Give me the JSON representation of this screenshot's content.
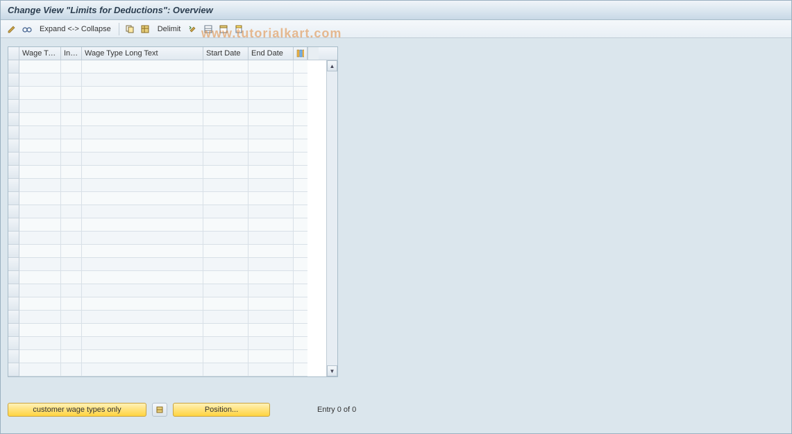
{
  "header": {
    "title": "Change View \"Limits for Deductions\": Overview"
  },
  "toolbar": {
    "expand_collapse_label": "Expand <-> Collapse",
    "delimit_label": "Delimit"
  },
  "table": {
    "columns": {
      "sel": "",
      "wage_type": "Wage Ty...",
      "inf": "Inf...",
      "long_text": "Wage Type Long Text",
      "start_date": "Start Date",
      "end_date": "End Date"
    },
    "rows": [
      {
        "wage_type": "",
        "inf": "",
        "long_text": "",
        "start_date": "",
        "end_date": ""
      },
      {
        "wage_type": "",
        "inf": "",
        "long_text": "",
        "start_date": "",
        "end_date": ""
      },
      {
        "wage_type": "",
        "inf": "",
        "long_text": "",
        "start_date": "",
        "end_date": ""
      },
      {
        "wage_type": "",
        "inf": "",
        "long_text": "",
        "start_date": "",
        "end_date": ""
      },
      {
        "wage_type": "",
        "inf": "",
        "long_text": "",
        "start_date": "",
        "end_date": ""
      },
      {
        "wage_type": "",
        "inf": "",
        "long_text": "",
        "start_date": "",
        "end_date": ""
      },
      {
        "wage_type": "",
        "inf": "",
        "long_text": "",
        "start_date": "",
        "end_date": ""
      },
      {
        "wage_type": "",
        "inf": "",
        "long_text": "",
        "start_date": "",
        "end_date": ""
      },
      {
        "wage_type": "",
        "inf": "",
        "long_text": "",
        "start_date": "",
        "end_date": ""
      },
      {
        "wage_type": "",
        "inf": "",
        "long_text": "",
        "start_date": "",
        "end_date": ""
      },
      {
        "wage_type": "",
        "inf": "",
        "long_text": "",
        "start_date": "",
        "end_date": ""
      },
      {
        "wage_type": "",
        "inf": "",
        "long_text": "",
        "start_date": "",
        "end_date": ""
      },
      {
        "wage_type": "",
        "inf": "",
        "long_text": "",
        "start_date": "",
        "end_date": ""
      },
      {
        "wage_type": "",
        "inf": "",
        "long_text": "",
        "start_date": "",
        "end_date": ""
      },
      {
        "wage_type": "",
        "inf": "",
        "long_text": "",
        "start_date": "",
        "end_date": ""
      },
      {
        "wage_type": "",
        "inf": "",
        "long_text": "",
        "start_date": "",
        "end_date": ""
      },
      {
        "wage_type": "",
        "inf": "",
        "long_text": "",
        "start_date": "",
        "end_date": ""
      },
      {
        "wage_type": "",
        "inf": "",
        "long_text": "",
        "start_date": "",
        "end_date": ""
      },
      {
        "wage_type": "",
        "inf": "",
        "long_text": "",
        "start_date": "",
        "end_date": ""
      },
      {
        "wage_type": "",
        "inf": "",
        "long_text": "",
        "start_date": "",
        "end_date": ""
      },
      {
        "wage_type": "",
        "inf": "",
        "long_text": "",
        "start_date": "",
        "end_date": ""
      },
      {
        "wage_type": "",
        "inf": "",
        "long_text": "",
        "start_date": "",
        "end_date": ""
      },
      {
        "wage_type": "",
        "inf": "",
        "long_text": "",
        "start_date": "",
        "end_date": ""
      },
      {
        "wage_type": "",
        "inf": "",
        "long_text": "",
        "start_date": "",
        "end_date": ""
      }
    ]
  },
  "footer": {
    "customer_wt_label": "customer wage types only",
    "position_label": "Position...",
    "entry_text": "Entry 0 of 0"
  },
  "watermark": "www.tutorialkart.com"
}
